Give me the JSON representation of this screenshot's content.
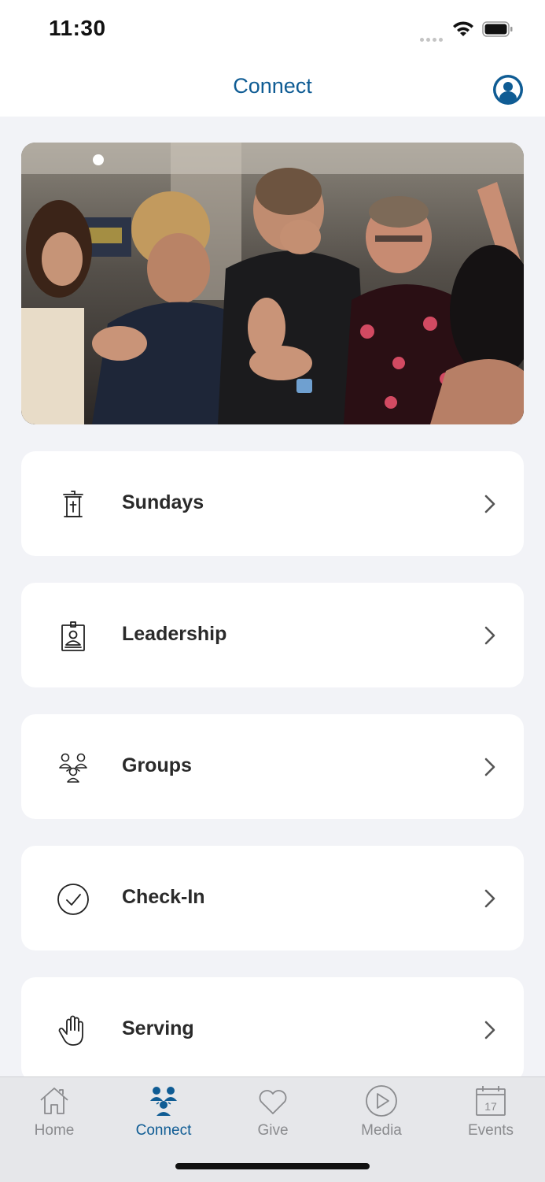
{
  "status_bar": {
    "time": "11:30"
  },
  "header": {
    "title": "Connect"
  },
  "menu": [
    {
      "label": "Sundays",
      "icon": "pulpit-icon"
    },
    {
      "label": "Leadership",
      "icon": "id-badge-icon"
    },
    {
      "label": "Groups",
      "icon": "group-icon"
    },
    {
      "label": "Check-In",
      "icon": "check-circle-icon"
    },
    {
      "label": "Serving",
      "icon": "raised-hand-icon"
    }
  ],
  "tabs": [
    {
      "label": "Home",
      "icon": "home-icon",
      "active": false
    },
    {
      "label": "Connect",
      "icon": "people-icon",
      "active": true
    },
    {
      "label": "Give",
      "icon": "heart-icon",
      "active": false
    },
    {
      "label": "Media",
      "icon": "play-icon",
      "active": false
    },
    {
      "label": "Events",
      "icon": "calendar-icon",
      "active": false
    }
  ],
  "colors": {
    "accent": "#0f5c94",
    "background": "#f2f3f7",
    "card": "#ffffff",
    "tab_inactive": "#8a8b8e"
  }
}
